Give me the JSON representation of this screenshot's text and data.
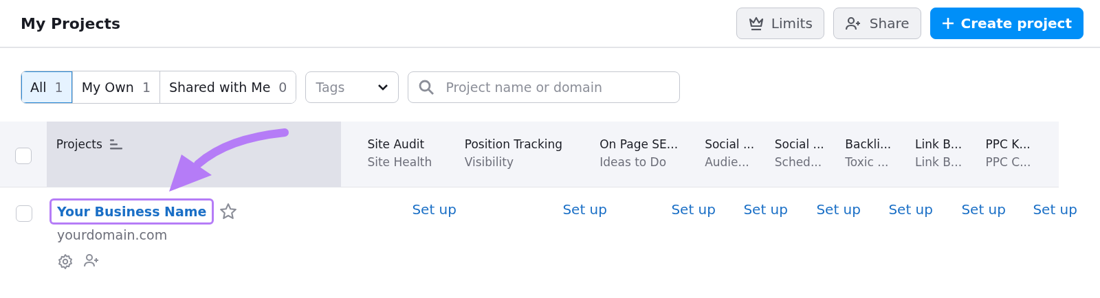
{
  "header": {
    "title": "My Projects",
    "buttons": [
      {
        "kind": "limits",
        "label": "Limits"
      },
      {
        "kind": "share",
        "label": "Share"
      },
      {
        "kind": "create",
        "label": "Create project"
      }
    ]
  },
  "filters": {
    "segments": [
      {
        "label": "All",
        "count": "1",
        "selected": true
      },
      {
        "label": "My Own",
        "count": "1",
        "selected": false
      },
      {
        "label": "Shared with Me",
        "count": "0",
        "selected": false
      }
    ],
    "tags": {
      "placeholder": "Tags"
    },
    "search": {
      "placeholder": "Project name or domain"
    }
  },
  "table": {
    "all_checked": false,
    "project_column": "Projects",
    "columns": [
      {
        "title": "Site Audit",
        "subtitle": "Site Health"
      },
      {
        "title": "Position Tracking",
        "subtitle": "Visibility"
      },
      {
        "title": "On Page SE...",
        "subtitle": "Ideas to Do"
      },
      {
        "title": "Social ...",
        "subtitle": "Audie..."
      },
      {
        "title": "Social ...",
        "subtitle": "Sched..."
      },
      {
        "title": "Backli...",
        "subtitle": "Toxic ..."
      },
      {
        "title": "Link B...",
        "subtitle": "Link B..."
      },
      {
        "title": "PPC K...",
        "subtitle": "PPC C..."
      }
    ],
    "rows": [
      {
        "name": "Your Business Name",
        "domain": "yourdomain.com",
        "checked": false,
        "starred": false,
        "cells": [
          "Set up",
          "Set up",
          "Set up",
          "Set up",
          "Set up",
          "Set up",
          "Set up",
          "Set up"
        ]
      }
    ]
  }
}
